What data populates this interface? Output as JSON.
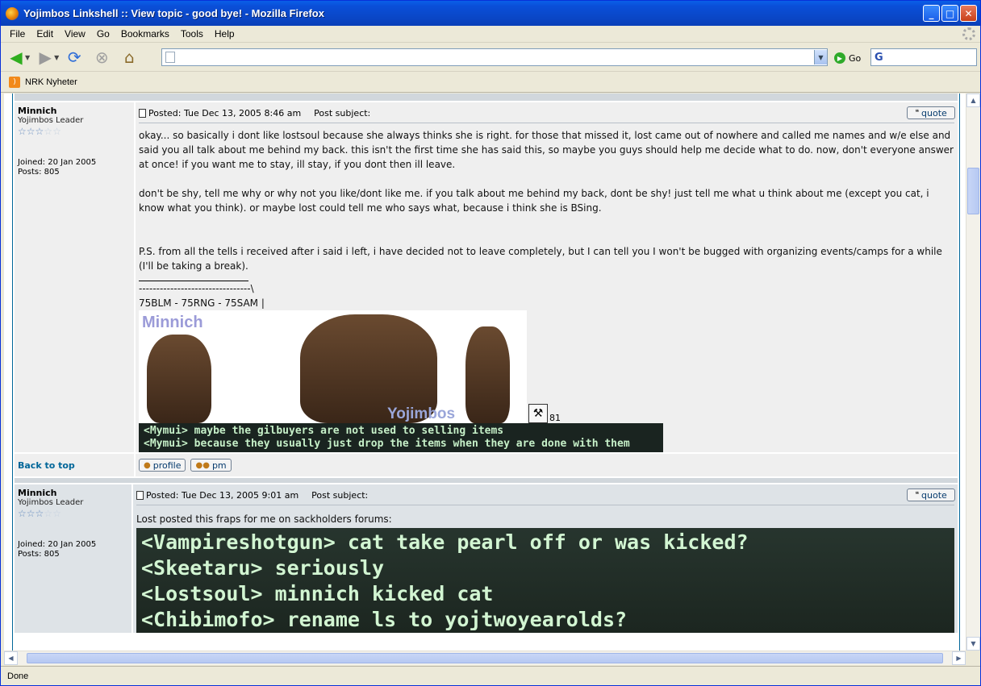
{
  "window": {
    "title": "Yojimbos Linkshell :: View topic - good bye! - Mozilla Firefox",
    "controls": {
      "minimize": "_",
      "maximize": "□",
      "close": "✕"
    }
  },
  "menubar": {
    "items": [
      "File",
      "Edit",
      "View",
      "Go",
      "Bookmarks",
      "Tools",
      "Help"
    ]
  },
  "navbar": {
    "url_value": "",
    "go_label": "Go",
    "search_value": ""
  },
  "bookmarks": {
    "items": [
      "NRK Nyheter"
    ]
  },
  "posts": [
    {
      "author": "Minnich",
      "rank": "Yojimbos Leader",
      "stars_filled": 3,
      "stars_total": 5,
      "joined": "Joined: 20 Jan 2005",
      "posts": "Posts: 805",
      "posted": "Posted: Tue Dec 13, 2005 8:46 am",
      "subject_label": "Post subject:",
      "quote_label": "quote",
      "body": [
        "okay... so basically i dont like lostsoul because she always thinks she is right. for those that missed it, lost came out of nowhere and called me names and w/e else and said you all talk about me behind my back. this isn't the first time she has said this, so maybe you guys should help me decide what to do. now, don't everyone answer at once! if you want me to stay, ill stay, if you dont then ill leave.",
        "don't be shy, tell me why or why not you like/dont like me. if you talk about me behind my back, dont be shy! just tell me what u think about me (except you cat, i know what you think). or maybe lost could tell me who says what, because i think she is BSing.",
        "P.S. from all the tells i received after i said i left, i have decided not to leave completely, but I can tell you I won't be bugged with organizing events/camps for a while (I'll be taking a break)."
      ],
      "sig_dashes": "--------------------------------\\",
      "sig_jobs": "75BLM - 75RNG - 75SAM |",
      "sig_banner_name": "Minnich",
      "sig_banner_ls": "Yojimbos",
      "sig_number": "81",
      "chat_lines": [
        "<Mymui> maybe the gilbuyers are not used to selling items",
        "<Mymui> because they usually just drop the items when they are done with them"
      ],
      "back_to_top": "Back to top",
      "profile_label": "profile",
      "pm_label": "pm"
    },
    {
      "author": "Minnich",
      "rank": "Yojimbos Leader",
      "stars_filled": 3,
      "stars_total": 5,
      "joined": "Joined: 20 Jan 2005",
      "posts": "Posts: 805",
      "posted": "Posted: Tue Dec 13, 2005 9:01 am",
      "subject_label": "Post subject:",
      "quote_label": "quote",
      "intro": "Lost posted this fraps for me on sackholders forums:",
      "chat_lines": [
        "<Vampireshotgun> cat take pearl off or was kicked?",
        "<Skeetaru> seriously",
        "<Lostsoul> minnich kicked cat",
        "<Chibimofo> rename ls to yojtwoyearolds?"
      ]
    }
  ],
  "status": {
    "text": "Done"
  },
  "icons": {
    "back": "back-arrow-icon",
    "forward": "forward-arrow-icon",
    "reload": "reload-icon",
    "stop": "stop-icon",
    "home": "home-icon",
    "rss": "rss-feed-icon",
    "go": "go-icon",
    "google": "google-search-icon"
  },
  "colors": {
    "titlebar": "#0a4fd9",
    "forum_link": "#006699",
    "row_light": "#efefef",
    "row_alt": "#dee3e7"
  }
}
